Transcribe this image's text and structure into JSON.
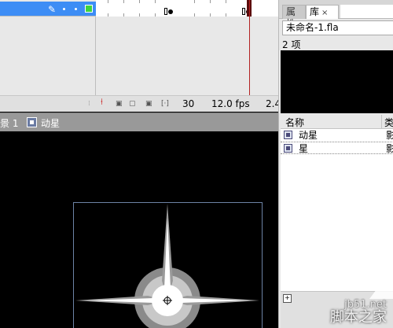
{
  "timeline": {
    "frame_number": "30",
    "fps": "12.0 fps",
    "elapsed": "2.4"
  },
  "panel": {
    "tab_properties": "属性",
    "tab_library": "库",
    "tab_close": "×",
    "document_name": "未命名-1.fla",
    "item_count": "2 项",
    "col_name": "名称",
    "col_type": "类",
    "items": [
      {
        "name": "动星",
        "type": "影"
      },
      {
        "name": "星",
        "type": "影"
      }
    ]
  },
  "edit_bar": {
    "scene_label": "景 1",
    "symbol_label": "动星"
  },
  "watermark": {
    "site": "jb51.net",
    "brand": "脚本之家"
  }
}
